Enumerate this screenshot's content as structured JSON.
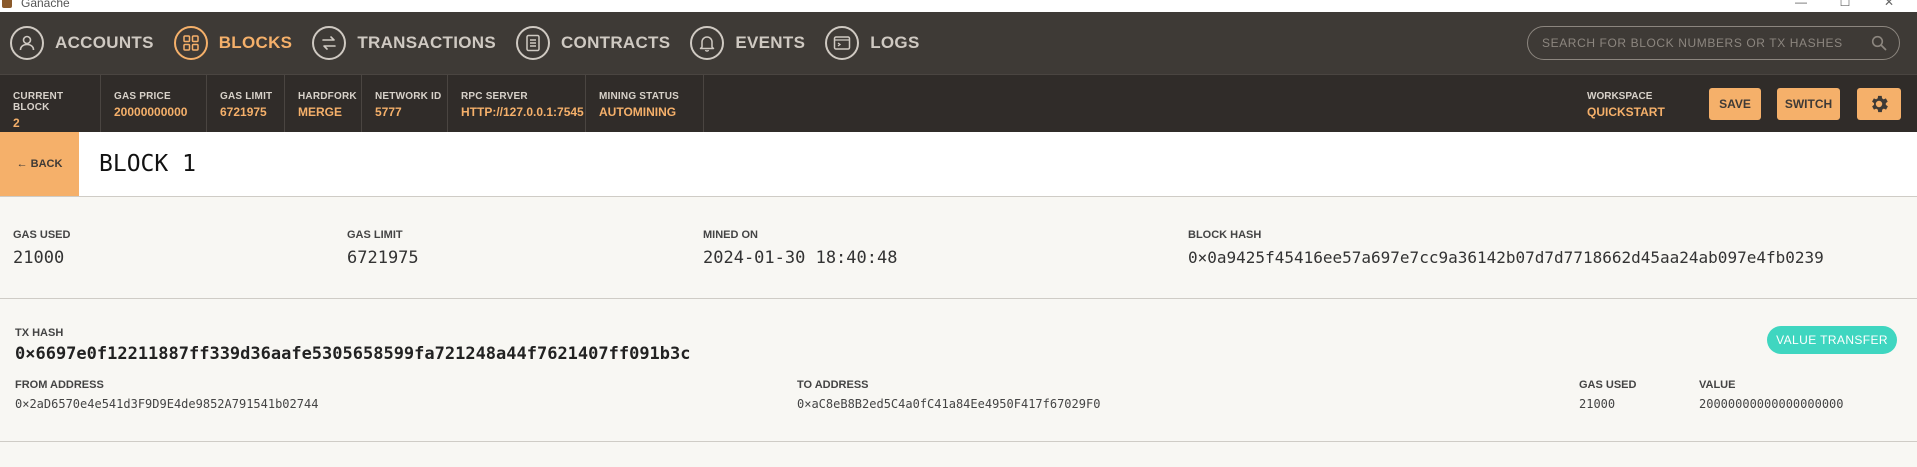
{
  "window": {
    "title": "Ganache",
    "controls": [
      "—",
      "☐",
      "✕"
    ]
  },
  "nav": {
    "items": [
      {
        "label": "ACCOUNTS",
        "icon": "user-icon",
        "active": false
      },
      {
        "label": "BLOCKS",
        "icon": "blocks-grid-icon",
        "active": true
      },
      {
        "label": "TRANSACTIONS",
        "icon": "transfer-arrows-icon",
        "active": false
      },
      {
        "label": "CONTRACTS",
        "icon": "document-icon",
        "active": false
      },
      {
        "label": "EVENTS",
        "icon": "bell-icon",
        "active": false
      },
      {
        "label": "LOGS",
        "icon": "terminal-icon",
        "active": false
      }
    ],
    "search_placeholder": "SEARCH FOR BLOCK NUMBERS OR TX HASHES"
  },
  "status": {
    "current_block": {
      "label": "CURRENT BLOCK",
      "value": "2"
    },
    "gas_price": {
      "label": "GAS PRICE",
      "value": "20000000000"
    },
    "gas_limit": {
      "label": "GAS LIMIT",
      "value": "6721975"
    },
    "hardfork": {
      "label": "HARDFORK",
      "value": "MERGE"
    },
    "network_id": {
      "label": "NETWORK ID",
      "value": "5777"
    },
    "rpc_server": {
      "label": "RPC SERVER",
      "value": "HTTP://127.0.0.1:7545"
    },
    "mining_status": {
      "label": "MINING STATUS",
      "value": "AUTOMINING"
    },
    "workspace": {
      "label": "WORKSPACE",
      "value": "QUICKSTART"
    },
    "save_label": "SAVE",
    "switch_label": "SWITCH"
  },
  "block": {
    "back_label": "← BACK",
    "title": "BLOCK 1",
    "gas_used": {
      "label": "GAS USED",
      "value": "21000"
    },
    "gas_limit": {
      "label": "GAS LIMIT",
      "value": "6721975"
    },
    "mined_on": {
      "label": "MINED ON",
      "value": "2024-01-30 18:40:48"
    },
    "block_hash": {
      "label": "BLOCK HASH",
      "value": "0×0a9425f45416ee57a697e7cc9a36142b07d7d7718662d45aa24ab097e4fb0239"
    }
  },
  "transaction": {
    "tx_hash_label": "TX HASH",
    "tx_hash": "0×6697e0f12211887ff339d36aafe5305658599fa721248a44f7621407ff091b3c",
    "type_badge": "VALUE TRANSFER",
    "from": {
      "label": "FROM ADDRESS",
      "value": "0×2aD6570e4e541d3F9D9E4de9852A791541b02744"
    },
    "to": {
      "label": "TO ADDRESS",
      "value": "0×aC8eB8B2ed5C4a0fC41a84Ee4950F417f67029F0"
    },
    "gas_used": {
      "label": "GAS USED",
      "value": "21000"
    },
    "value": {
      "label": "VALUE",
      "value": "20000000000000000000"
    }
  },
  "colors": {
    "accent": "#f5b06a",
    "nav_bg": "#3e3a36",
    "status_bg": "#302c29",
    "badge": "#3fd6c0",
    "page_bg": "#f8f7f3"
  }
}
